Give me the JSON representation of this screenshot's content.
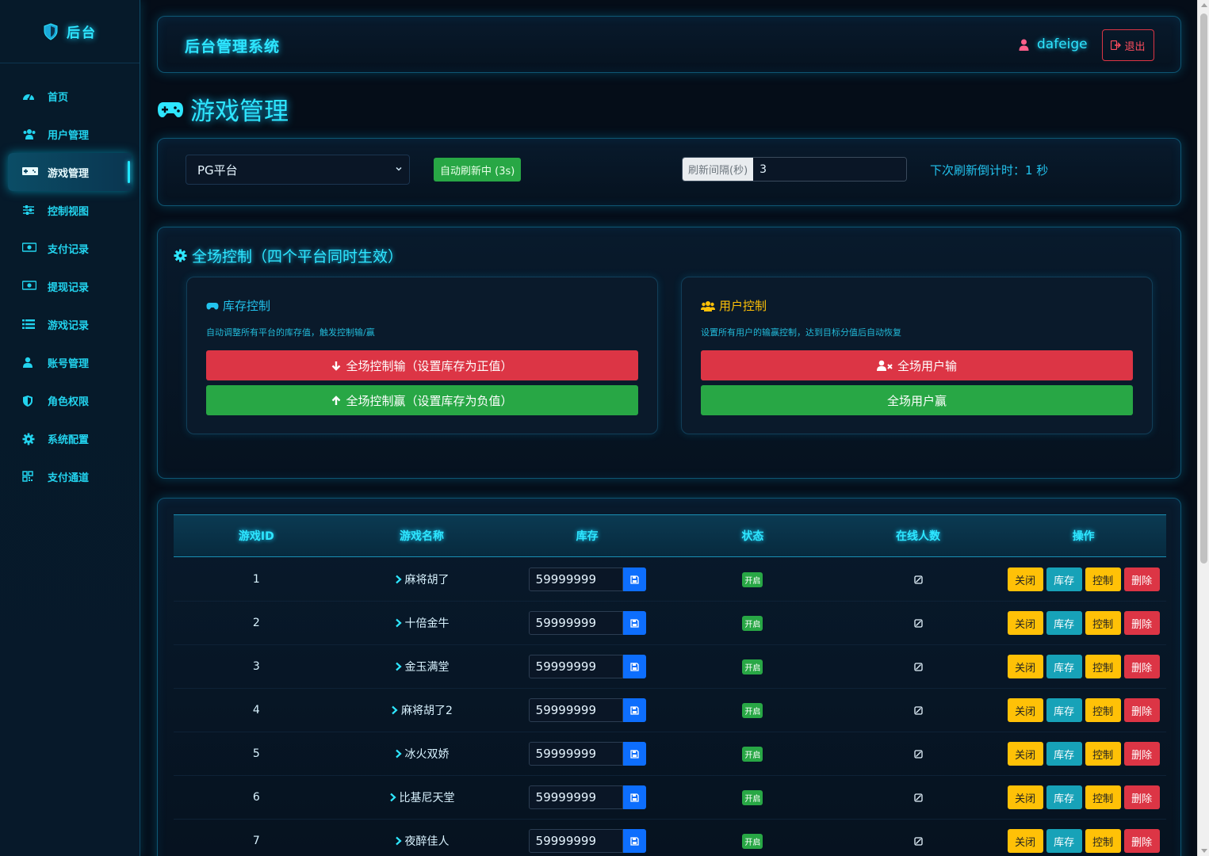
{
  "brand": {
    "text": "后台"
  },
  "sidebar": {
    "items": [
      {
        "label": "首页",
        "icon": "dashboard-icon"
      },
      {
        "label": "用户管理",
        "icon": "users-icon"
      },
      {
        "label": "游戏管理",
        "icon": "gamepad-icon",
        "active": true
      },
      {
        "label": "控制视图",
        "icon": "sliders-icon"
      },
      {
        "label": "支付记录",
        "icon": "money-icon"
      },
      {
        "label": "提现记录",
        "icon": "money-icon"
      },
      {
        "label": "游戏记录",
        "icon": "list-icon"
      },
      {
        "label": "账号管理",
        "icon": "user-icon"
      },
      {
        "label": "角色权限",
        "icon": "shield-icon"
      },
      {
        "label": "系统配置",
        "icon": "gear-icon"
      },
      {
        "label": "支付通道",
        "icon": "qrcode-icon"
      }
    ]
  },
  "header": {
    "title": "后台管理系统",
    "username": "dafeige",
    "logout_label": "退出"
  },
  "page": {
    "title": "游戏管理"
  },
  "filter": {
    "platform_selected": "PG平台",
    "auto_refresh_label": "自动刷新中 (3s)",
    "interval_label": "刷新间隔(秒)",
    "interval_value": "3",
    "countdown_text": "下次刷新倒计时：1 秒"
  },
  "global_control": {
    "title": "全场控制（四个平台同时生效）",
    "stock_card": {
      "title": "库存控制",
      "desc": "自动调整所有平台的库存值，触发控制输/赢",
      "lose_btn": "全场控制输（设置库存为正值）",
      "win_btn": "全场控制赢（设置库存为负值）"
    },
    "user_card": {
      "title": "用户控制",
      "desc": "设置所有用户的输赢控制，达到目标分值后自动恢复",
      "lose_btn": "全场用户输",
      "win_btn": "全场用户赢"
    }
  },
  "table": {
    "headers": [
      "游戏ID",
      "游戏名称",
      "库存",
      "状态",
      "在线人数",
      "操作"
    ],
    "op_labels": {
      "close": "关闭",
      "stock": "库存",
      "control": "控制",
      "delete": "删除"
    },
    "rows": [
      {
        "id": "1",
        "name": "麻将胡了",
        "stock": "59999999",
        "status": "开启"
      },
      {
        "id": "2",
        "name": "十倍金牛",
        "stock": "59999999",
        "status": "开启"
      },
      {
        "id": "3",
        "name": "金玉满堂",
        "stock": "59999999",
        "status": "开启"
      },
      {
        "id": "4",
        "name": "麻将胡了2",
        "stock": "59999999",
        "status": "开启"
      },
      {
        "id": "5",
        "name": "冰火双娇",
        "stock": "59999999",
        "status": "开启"
      },
      {
        "id": "6",
        "name": "比基尼天堂",
        "stock": "59999999",
        "status": "开启"
      },
      {
        "id": "7",
        "name": "夜醉佳人",
        "stock": "59999999",
        "status": "开启"
      }
    ]
  },
  "colors": {
    "accent": "#2ee6ff",
    "danger": "#dc3545",
    "success": "#28a745",
    "warning": "#ffc107",
    "info": "#17a2b8",
    "primary": "#0d6efd"
  }
}
